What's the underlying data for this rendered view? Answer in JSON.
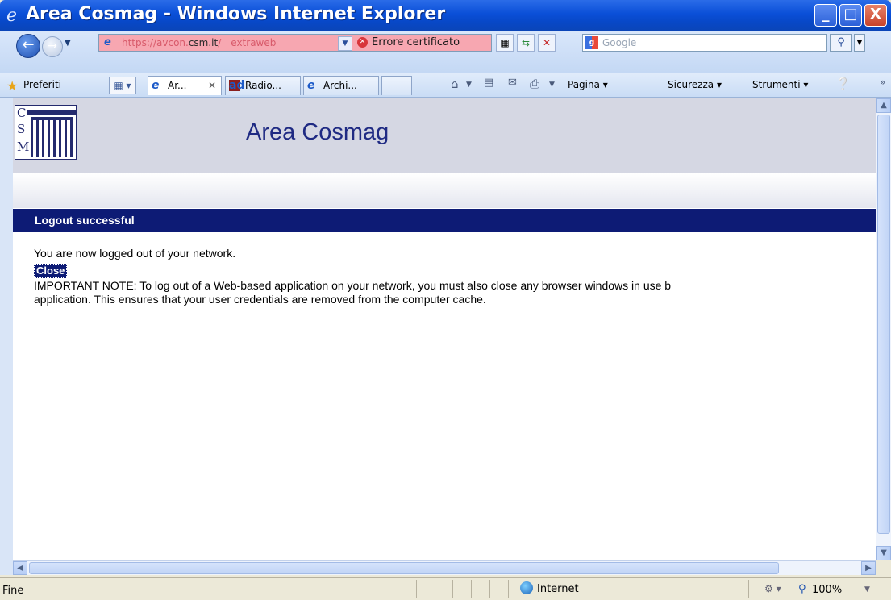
{
  "window": {
    "title": "Area Cosmag - Windows Internet Explorer",
    "min": "_",
    "max": "□",
    "close": "X"
  },
  "address": {
    "url_prefix": "https://avcon.",
    "url_host": "csm.it",
    "url_suffix": "/__extraweb__",
    "cert_error": "Errore certificato"
  },
  "search": {
    "placeholder": "Google"
  },
  "favorites": {
    "label": "Preferiti"
  },
  "tabs": [
    {
      "label": "Ar...",
      "active": true
    },
    {
      "label": "Radio...",
      "active": false
    },
    {
      "label": "Archi...",
      "active": false
    }
  ],
  "commands": {
    "pagina": "Pagina",
    "sicurezza": "Sicurezza",
    "strumenti": "Strumenti"
  },
  "page": {
    "site_title": "Area Cosmag",
    "logo_letters": [
      "C",
      "S",
      "M"
    ],
    "message_title": "Logout successful",
    "logged_out": "You are now logged out of your network.",
    "close_button": "Close",
    "note_line1": "IMPORTANT NOTE: To log out of a Web-based application on your network, you must also close any browser windows in use b",
    "note_line2": "application. This ensures that your user credentials are removed from the computer cache."
  },
  "status": {
    "text": "Fine",
    "zone": "Internet",
    "zoom": "100%"
  },
  "colors": {
    "title_bar": "#0A4FD8",
    "header_band": "#D5D7E3",
    "message_bar": "#0D1B75",
    "site_title": "#1F2A83",
    "cert_error_bg": "#F7A7B1"
  }
}
